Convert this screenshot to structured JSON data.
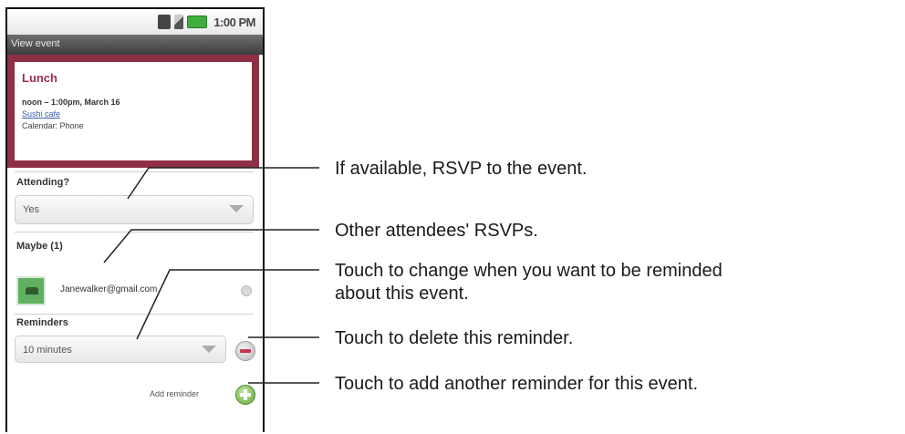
{
  "status_bar": {
    "time": "1:00 PM"
  },
  "title_bar": {
    "title": "View event"
  },
  "event": {
    "title": "Lunch",
    "time": "noon – 1:00pm, March 16",
    "location": "Sushi cafe",
    "calendar": "Calendar: Phone"
  },
  "attending": {
    "label": "Attending?",
    "value": "Yes"
  },
  "maybe": {
    "label": "Maybe (1)",
    "attendee_email": "Janewalker@gmail.com"
  },
  "reminders": {
    "label": "Reminders",
    "value": "10 minutes",
    "add_label": "Add reminder"
  },
  "callouts": [
    "If available, RSVP to the event.",
    "Other attendees' RSVPs.",
    "Touch to change when you want to be reminded",
    "about this event.",
    "Touch to delete this reminder.",
    "Touch to add another reminder for this event."
  ],
  "colors": {
    "event_border": "#8e2f46",
    "event_title": "#9a2f4a",
    "delete_icon": "#c8344e",
    "add_icon": "#62a83a"
  }
}
